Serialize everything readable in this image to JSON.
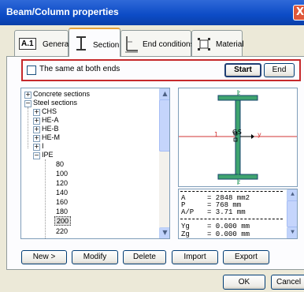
{
  "window": {
    "title": "Beam/Column properties",
    "close_glyph": "X"
  },
  "tabs": [
    {
      "icon_text": "A.1",
      "label": "General"
    },
    {
      "label": "Section"
    },
    {
      "label": "End conditions"
    },
    {
      "label": "Material"
    }
  ],
  "section": {
    "same_both_ends_label": "The same at both ends",
    "same_both_ends_checked": false,
    "start_label": "Start",
    "end_label": "End"
  },
  "tree": {
    "items": [
      {
        "label": "Concrete sections"
      },
      {
        "label": "Steel sections"
      },
      {
        "label": "CHS"
      },
      {
        "label": "HE-A"
      },
      {
        "label": "HE-B"
      },
      {
        "label": "HE-M"
      },
      {
        "label": "I"
      },
      {
        "label": "IPE"
      },
      {
        "label": "80"
      },
      {
        "label": "100"
      },
      {
        "label": "120"
      },
      {
        "label": "140"
      },
      {
        "label": "160"
      },
      {
        "label": "180"
      },
      {
        "label": "200"
      },
      {
        "label": "220"
      }
    ],
    "selected": "200"
  },
  "preview": {
    "z_label_top": "z",
    "z_label_bottom": "z",
    "y_label": "y",
    "axis_1_label": "1",
    "axis_2_label": "2",
    "centroid_label": "G S"
  },
  "properties": [
    {
      "name": "A",
      "value": "= 2848 mm2"
    },
    {
      "name": "P",
      "value": "= 768 mm"
    },
    {
      "name": "A/P",
      "value": "= 3.71 mm"
    },
    {
      "name": "Yg",
      "value": "= 0.000 mm"
    },
    {
      "name": "Zg",
      "value": "= 0.000 mm"
    }
  ],
  "buttons": {
    "new": "New >",
    "modify": "Modify",
    "delete": "Delete",
    "import": "Import",
    "export": "Export",
    "ok": "OK",
    "cancel": "Cancel"
  },
  "colors": {
    "highlight_border": "#c6282b",
    "titlebar": "#0c4bc6",
    "active_tab_accent": "#e8a33a",
    "section_fill": "#3fa36f",
    "section_edge": "#16456b",
    "y_axis": "#d23434",
    "z_axis": "#3fa36f"
  }
}
